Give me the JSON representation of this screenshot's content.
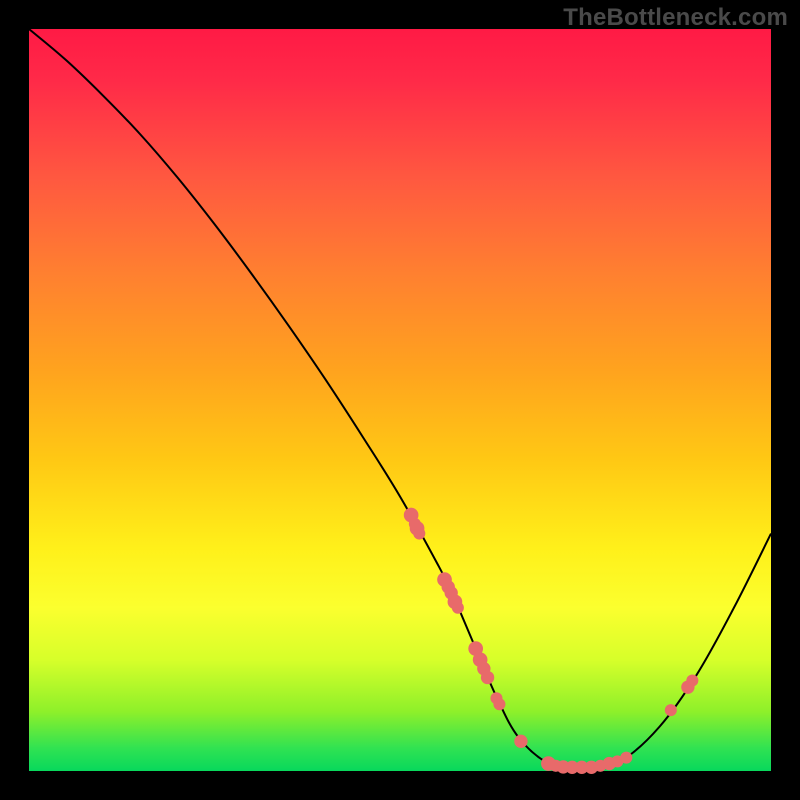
{
  "watermark": "TheBottleneck.com",
  "chart_data": {
    "type": "line",
    "title": "",
    "xlabel": "",
    "ylabel": "",
    "xlim": [
      0,
      100
    ],
    "ylim": [
      0,
      100
    ],
    "grid": false,
    "legend": false,
    "series": [
      {
        "name": "curve",
        "x": [
          0,
          5,
          10,
          15,
          20,
          25,
          30,
          35,
          40,
          45,
          50,
          55,
          57,
          60,
          63,
          66,
          70,
          73,
          76,
          80,
          85,
          90,
          95,
          100
        ],
        "y": [
          100,
          95.8,
          91,
          85.8,
          80,
          73.7,
          67,
          60,
          52.7,
          45,
          37,
          28,
          24,
          17,
          10,
          4.5,
          1,
          0.5,
          0.5,
          1.5,
          6,
          13,
          22,
          32
        ]
      }
    ],
    "markers": [
      {
        "x": 51.5,
        "y": 34.5,
        "r": 1.1
      },
      {
        "x": 52.0,
        "y": 33.3,
        "r": 0.9
      },
      {
        "x": 52.3,
        "y": 32.7,
        "r": 1.1
      },
      {
        "x": 52.6,
        "y": 32.0,
        "r": 0.9
      },
      {
        "x": 56.0,
        "y": 25.8,
        "r": 1.1
      },
      {
        "x": 56.5,
        "y": 24.8,
        "r": 1.0
      },
      {
        "x": 56.9,
        "y": 24.0,
        "r": 1.0
      },
      {
        "x": 57.4,
        "y": 22.8,
        "r": 1.1
      },
      {
        "x": 57.8,
        "y": 22.0,
        "r": 0.9
      },
      {
        "x": 60.2,
        "y": 16.5,
        "r": 1.1
      },
      {
        "x": 60.8,
        "y": 15.0,
        "r": 1.1
      },
      {
        "x": 61.3,
        "y": 13.8,
        "r": 1.0
      },
      {
        "x": 61.8,
        "y": 12.6,
        "r": 1.0
      },
      {
        "x": 63.0,
        "y": 9.8,
        "r": 0.9
      },
      {
        "x": 63.4,
        "y": 9.0,
        "r": 0.9
      },
      {
        "x": 66.3,
        "y": 4.0,
        "r": 1.0
      },
      {
        "x": 70.0,
        "y": 1.0,
        "r": 1.1
      },
      {
        "x": 71.0,
        "y": 0.7,
        "r": 0.9
      },
      {
        "x": 72.0,
        "y": 0.55,
        "r": 1.0
      },
      {
        "x": 73.2,
        "y": 0.5,
        "r": 1.0
      },
      {
        "x": 74.5,
        "y": 0.5,
        "r": 1.0
      },
      {
        "x": 75.8,
        "y": 0.5,
        "r": 1.0
      },
      {
        "x": 77.0,
        "y": 0.7,
        "r": 0.9
      },
      {
        "x": 78.2,
        "y": 1.0,
        "r": 1.0
      },
      {
        "x": 79.3,
        "y": 1.3,
        "r": 0.9
      },
      {
        "x": 80.5,
        "y": 1.8,
        "r": 0.9
      },
      {
        "x": 86.5,
        "y": 8.2,
        "r": 0.9
      },
      {
        "x": 88.8,
        "y": 11.3,
        "r": 1.0
      },
      {
        "x": 89.4,
        "y": 12.2,
        "r": 0.9
      }
    ],
    "colors": {
      "curve": "#000000",
      "markers": "#e86a6a",
      "gradient_top": "#ff1a45",
      "gradient_bottom": "#08d85c"
    }
  }
}
